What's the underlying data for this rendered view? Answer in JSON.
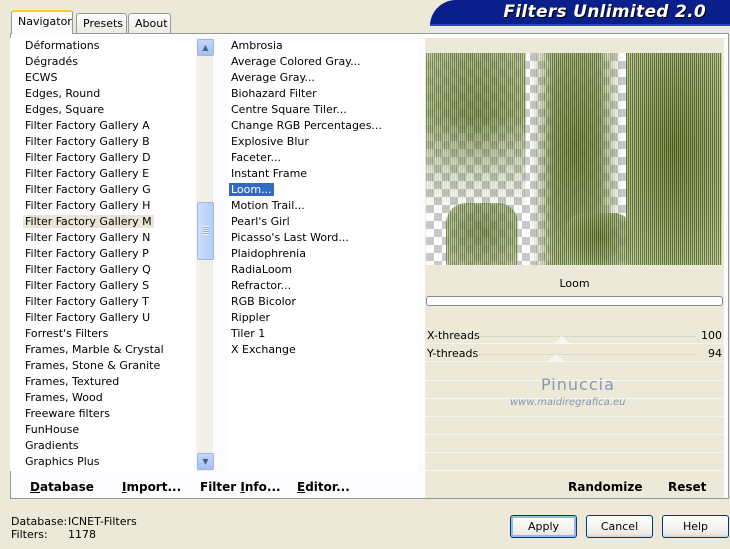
{
  "tabs": [
    {
      "label": "Navigator",
      "active": true
    },
    {
      "label": "Presets",
      "active": false
    },
    {
      "label": "About",
      "active": false
    }
  ],
  "banner": {
    "title": "Filters Unlimited 2.0"
  },
  "categories": {
    "items": [
      "Déformations",
      "Dégradés",
      "ECWS",
      "Edges, Round",
      "Edges, Square",
      "Filter Factory Gallery A",
      "Filter Factory Gallery B",
      "Filter Factory Gallery D",
      "Filter Factory Gallery E",
      "Filter Factory Gallery G",
      "Filter Factory Gallery H",
      "Filter Factory Gallery M",
      "Filter Factory Gallery N",
      "Filter Factory Gallery P",
      "Filter Factory Gallery Q",
      "Filter Factory Gallery S",
      "Filter Factory Gallery T",
      "Filter Factory Gallery U",
      "Forrest's Filters",
      "Frames, Marble & Crystal",
      "Frames, Stone & Granite",
      "Frames, Textured",
      "Frames, Wood",
      "Freeware filters",
      "FunHouse",
      "Gradients",
      "Graphics Plus"
    ],
    "selected": "Filter Factory Gallery M"
  },
  "filters": {
    "items": [
      "Ambrosia",
      "Average Colored Gray...",
      "Average Gray...",
      "Biohazard Filter",
      "Centre Square Tiler...",
      "Change RGB Percentages...",
      "Explosive Blur",
      "Faceter...",
      "Instant Frame",
      "Loom...",
      "Motion Trail...",
      "Pearl's Girl",
      "Picasso's Last Word...",
      "Plaidophrenia",
      "RadiaLoom",
      "Refractor...",
      "RGB Bicolor",
      "Rippler",
      "Tiler 1",
      "X Exchange"
    ],
    "selected": "Loom..."
  },
  "preview": {
    "filter_name": "Loom"
  },
  "params": [
    {
      "name": "X-threads",
      "value": "100",
      "level": 100
    },
    {
      "name": "Y-threads",
      "value": "94",
      "level": 94
    }
  ],
  "watermark": {
    "name": "Pinuccia",
    "site": "www.maidiregrafica.eu"
  },
  "actions": {
    "database": {
      "underlined": "D",
      "rest": "atabase"
    },
    "import": {
      "underlined": "I",
      "rest": "mport..."
    },
    "filter_info": {
      "prefix": "Filter ",
      "underlined": "I",
      "rest": "nfo..."
    },
    "editor": {
      "underlined": "E",
      "rest": "ditor..."
    },
    "randomize": "Randomize",
    "reset": "Reset"
  },
  "footer": {
    "database_label": "Database:",
    "database_value": "ICNET-Filters",
    "filters_label": "Filters:",
    "filters_value": "1178"
  },
  "buttons": {
    "apply": "Apply",
    "cancel": "Cancel",
    "help": "Help"
  },
  "icons": {
    "scroll_up": "chevron-up-icon",
    "scroll_down": "chevron-down-icon"
  },
  "colors": {
    "banner": "#0b1f8a",
    "selection": "#316ac5",
    "background": "#ece9d8"
  }
}
